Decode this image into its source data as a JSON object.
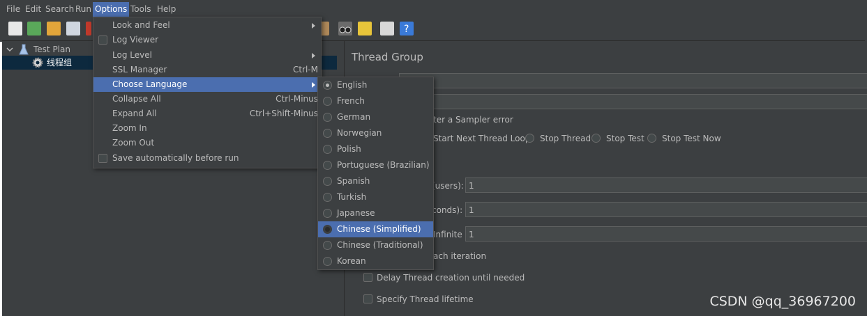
{
  "menubar": {
    "items": [
      "File",
      "Edit",
      "Search",
      "Run",
      "Options",
      "Tools",
      "Help"
    ],
    "active": "Options"
  },
  "tree": {
    "root_label": "Test Plan",
    "child_label": "线程组"
  },
  "options_menu": {
    "items": [
      {
        "label": "Look and Feel",
        "accel": "",
        "submenu": true
      },
      {
        "label": "Log Viewer",
        "accel": "",
        "checkbox": true
      },
      {
        "label": "Log Level",
        "accel": "",
        "submenu": true
      },
      {
        "label": "SSL Manager",
        "accel": "Ctrl-M"
      },
      {
        "label": "Choose Language",
        "accel": "",
        "submenu": true
      },
      {
        "label": "Collapse All",
        "accel": "Ctrl-Minus"
      },
      {
        "label": "Expand All",
        "accel": "Ctrl+Shift-Minus"
      },
      {
        "label": "Zoom In",
        "accel": ""
      },
      {
        "label": "Zoom Out",
        "accel": ""
      },
      {
        "label": "Save automatically before run",
        "accel": "",
        "checkbox": true
      }
    ]
  },
  "language_menu": {
    "items": [
      "English",
      "French",
      "German",
      "Norwegian",
      "Polish",
      "Portuguese (Brazilian)",
      "Spanish",
      "Turkish",
      "Japanese",
      "Chinese (Simplified)",
      "Chinese (Traditional)",
      "Korean"
    ],
    "selected": "English",
    "highlighted": "Chinese (Simplified)"
  },
  "panel": {
    "title": "Thread Group",
    "sampler_error_label": "ter a Sampler error",
    "radio_options": [
      "Start Next Thread Loop",
      "Stop Thread",
      "Stop Test",
      "Stop Test Now"
    ],
    "users_label": "(users):",
    "users_value": "1",
    "seconds_label": "conds):",
    "seconds_value": "1",
    "loop_label": "Infinite",
    "loop_value": "1",
    "iteration_label": "ach iteration",
    "delay_label": "Delay Thread creation until needed",
    "lifetime_label": "Specify Thread lifetime"
  },
  "watermark": "CSDN @qq_36967200"
}
